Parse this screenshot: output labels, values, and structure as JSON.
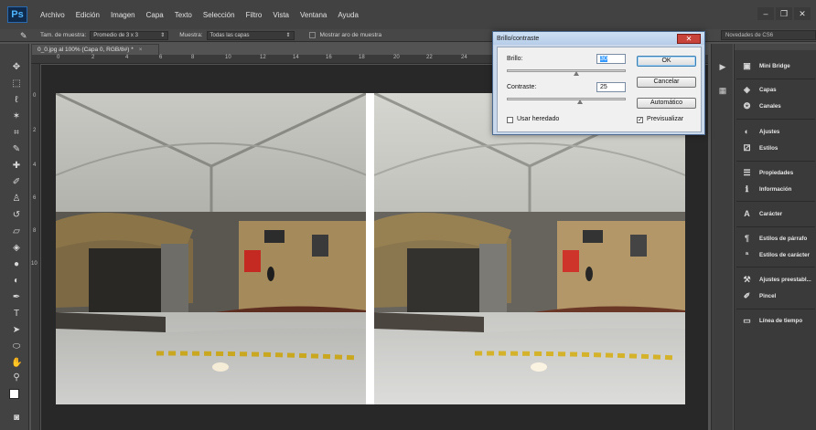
{
  "app": {
    "logo": "Ps"
  },
  "menu": [
    "Archivo",
    "Edición",
    "Imagen",
    "Capa",
    "Texto",
    "Selección",
    "Filtro",
    "Vista",
    "Ventana",
    "Ayuda"
  ],
  "window_buttons": {
    "minimize": "–",
    "restore": "❐",
    "close": "✕"
  },
  "options_bar": {
    "sample_size_label": "Tam. de muestra:",
    "sample_size_value": "Promedio de 3 x 3",
    "sample_label": "Muestra:",
    "sample_value": "Todas las capas",
    "show_ring_label": "Mostrar aro de muestra",
    "workspace_value": "Novedades de CS6"
  },
  "document": {
    "tab_title": "0_0.jpg al 100% (Capa 0, RGB/8#) *",
    "tab_close": "×",
    "ruler_top": [
      "0",
      "2",
      "4",
      "6",
      "8",
      "10",
      "12",
      "14",
      "16",
      "18",
      "20",
      "22",
      "24",
      "26"
    ],
    "ruler_left": [
      "0",
      "2",
      "4",
      "6",
      "8",
      "10"
    ]
  },
  "dialog": {
    "title": "Brillo/contraste",
    "close": "✕",
    "brightness_label": "Brillo:",
    "brightness_value": "30",
    "contrast_label": "Contraste:",
    "contrast_value": "25",
    "use_legacy_label": "Usar heredado",
    "use_legacy_checked": false,
    "preview_label": "Previsualizar",
    "preview_checked": true,
    "ok": "OK",
    "cancel": "Cancelar",
    "auto": "Automático"
  },
  "panels": [
    {
      "label": "Mini Bridge",
      "icon": "mini-bridge-icon"
    },
    {
      "label": "Capas",
      "icon": "layers-icon"
    },
    {
      "label": "Canales",
      "icon": "channels-icon"
    },
    {
      "label": "Ajustes",
      "icon": "adjustments-icon"
    },
    {
      "label": "Estilos",
      "icon": "styles-icon"
    },
    {
      "label": "Propiedades",
      "icon": "properties-icon"
    },
    {
      "label": "Información",
      "icon": "info-icon"
    },
    {
      "label": "Carácter",
      "icon": "character-icon"
    },
    {
      "label": "Estilos de párrafo",
      "icon": "paragraph-styles-icon"
    },
    {
      "label": "Estilos de carácter",
      "icon": "character-styles-icon"
    },
    {
      "label": "Ajustes preestabl...",
      "icon": "tool-presets-icon"
    },
    {
      "label": "Pincel",
      "icon": "brush-icon"
    },
    {
      "label": "Línea de tiempo",
      "icon": "timeline-icon"
    }
  ],
  "colors": {
    "accent": "#3399ff",
    "canvas": "#282828",
    "dialog_frame": "#c9d8ea"
  }
}
